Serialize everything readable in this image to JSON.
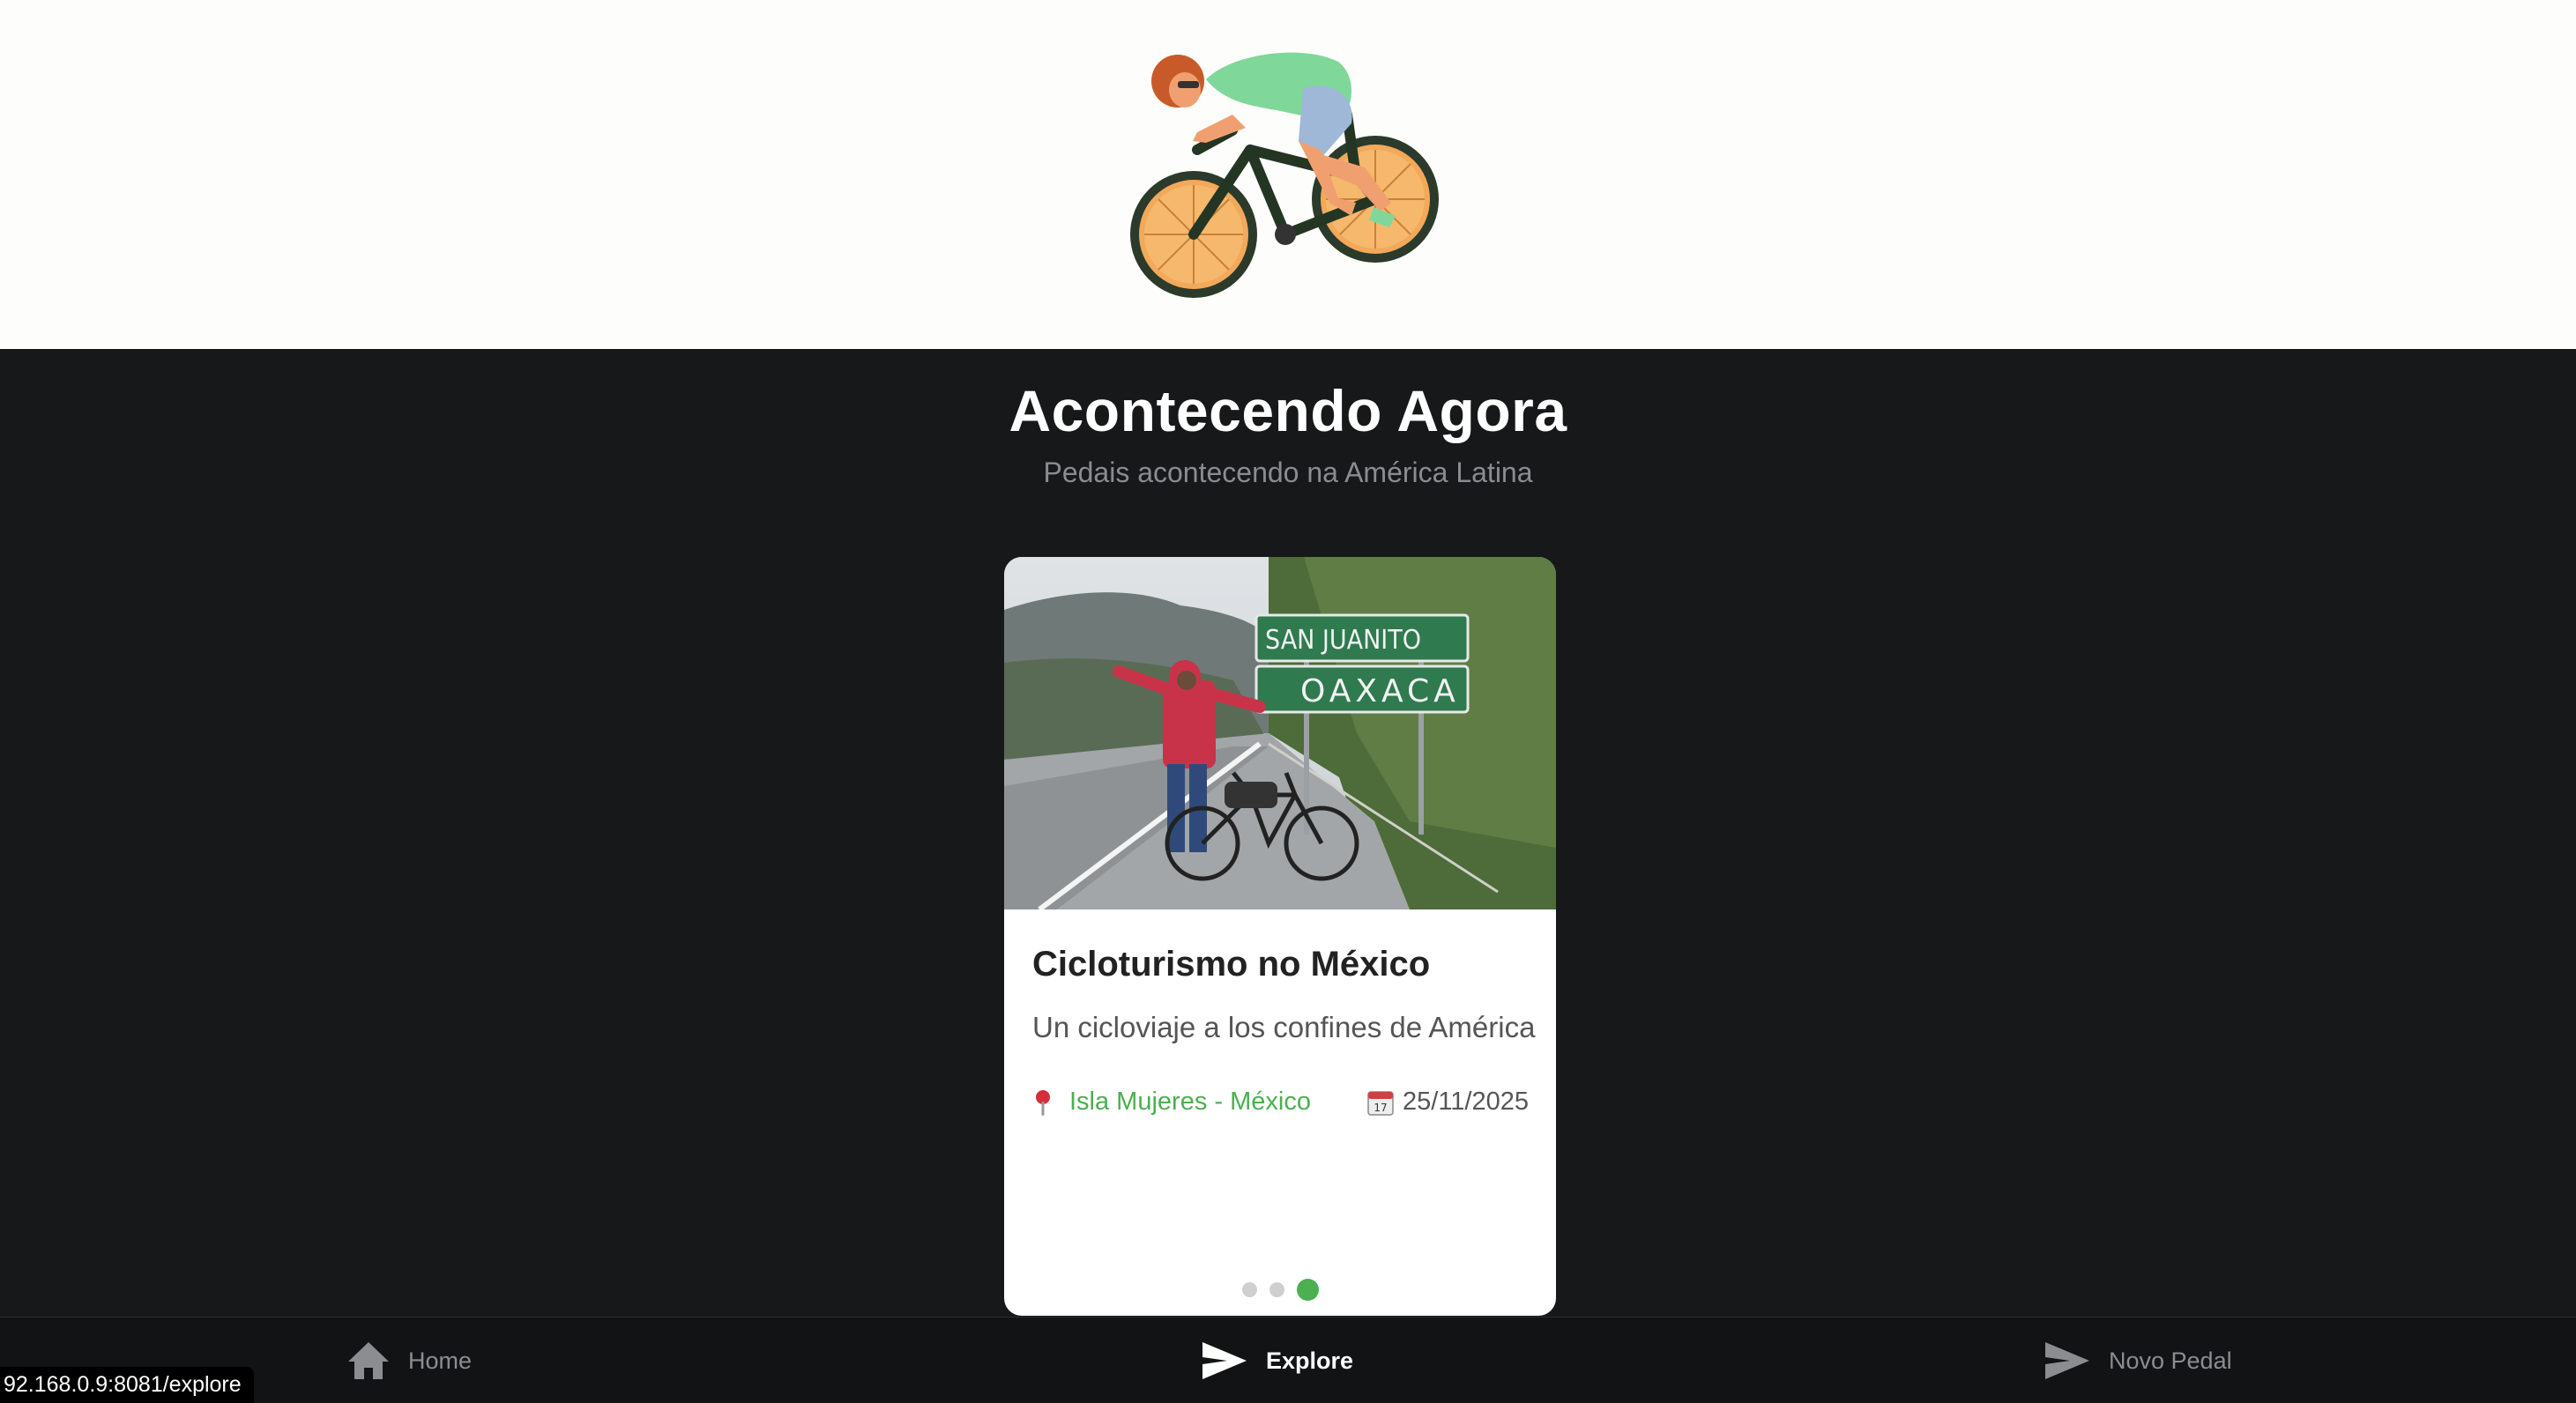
{
  "header": {
    "logo_icon": "cyclist-logo-icon"
  },
  "main": {
    "title": "Acontecendo Agora",
    "subtitle": "Pedais acontecendo na América Latina"
  },
  "card": {
    "photo_signs": [
      "SAN JUANITO",
      "OAXACA"
    ],
    "title": "Cicloturismo no México",
    "description": "Un cicloviaje a los confines de América",
    "location_icon": "map-pin-icon",
    "location": "Isla Mujeres - México",
    "date_icon": "calendar-icon",
    "date": "25/11/2025",
    "carousel": {
      "count": 3,
      "active_index": 2
    }
  },
  "tabbar": {
    "tabs": [
      {
        "label": "Home",
        "icon": "home-icon",
        "active": false
      },
      {
        "label": "Explore",
        "icon": "send-icon",
        "active": true
      },
      {
        "label": "Novo Pedal",
        "icon": "send-icon",
        "active": false
      }
    ]
  },
  "status_url": "92.168.0.9:8081/explore",
  "colors": {
    "accent": "#4caf50",
    "background": "#17181a",
    "header_bg": "#fdfdfb"
  }
}
